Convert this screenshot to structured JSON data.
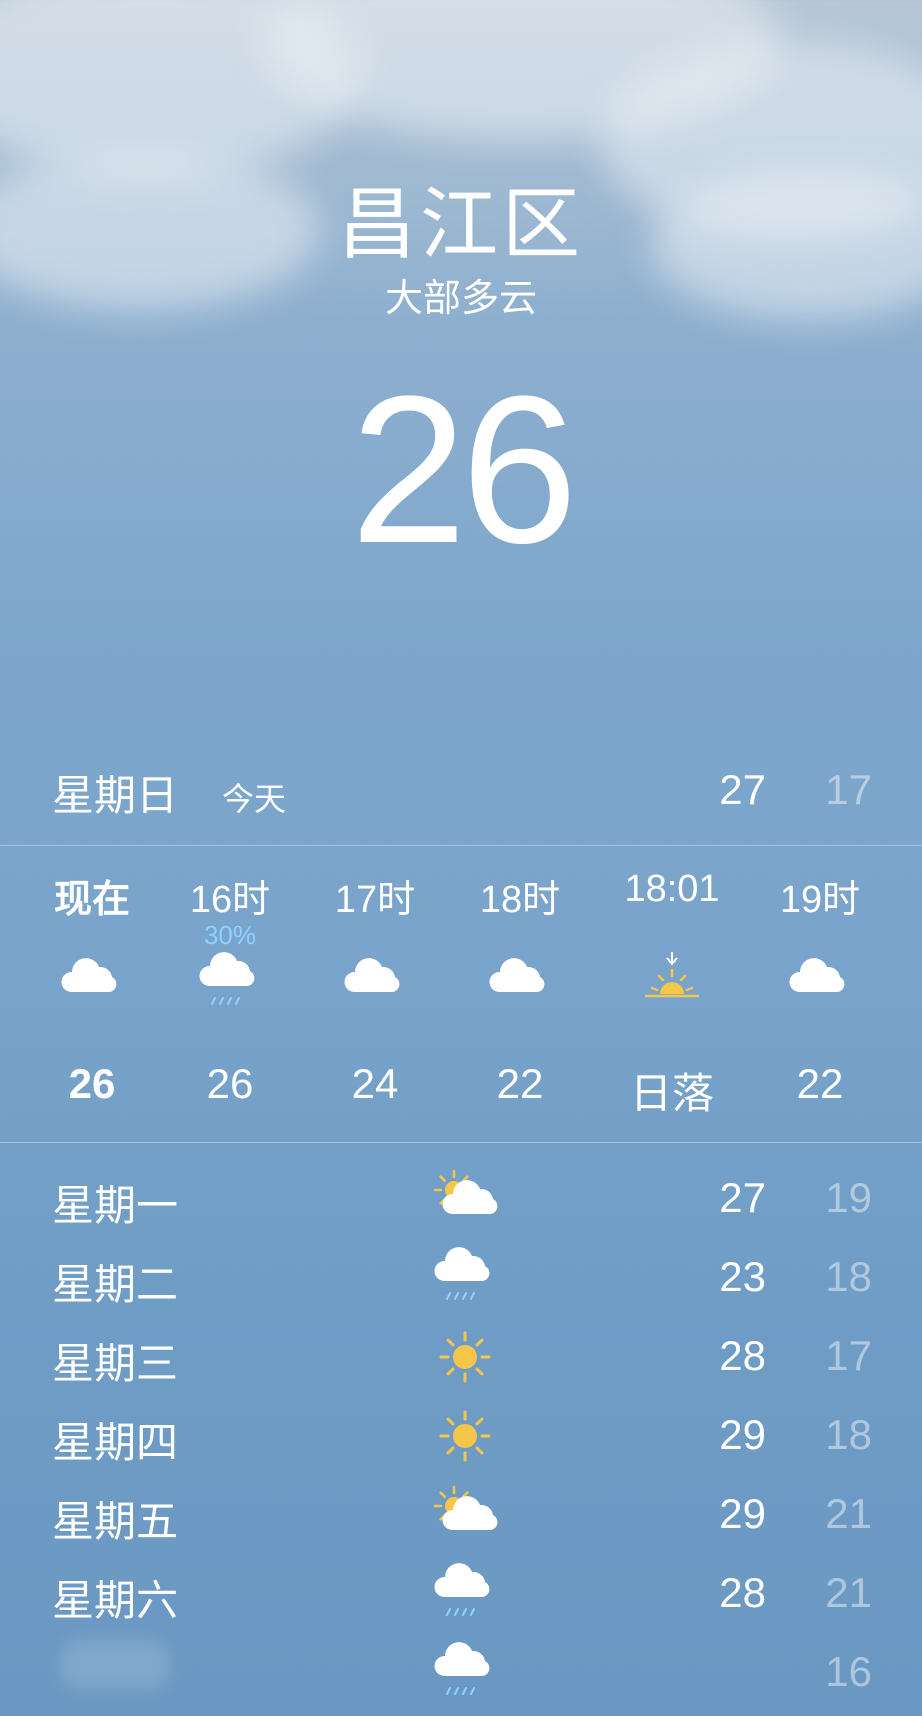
{
  "location": {
    "city": "昌江区",
    "condition": "大部多云",
    "temperature": "26"
  },
  "today": {
    "day": "星期日",
    "tag": "今天",
    "high": "27",
    "low": "17"
  },
  "hourly": [
    {
      "time": "现在",
      "icon": "cloud-icon",
      "value": "26",
      "bold": true,
      "precip": ""
    },
    {
      "time": "16时",
      "icon": "cloud-rain-icon",
      "value": "26",
      "bold": false,
      "precip": "30%"
    },
    {
      "time": "17时",
      "icon": "cloud-icon",
      "value": "24",
      "bold": false,
      "precip": ""
    },
    {
      "time": "18时",
      "icon": "cloud-icon",
      "value": "22",
      "bold": false,
      "precip": ""
    },
    {
      "time": "18:01",
      "icon": "sunset-icon",
      "value": "日落",
      "bold": false,
      "precip": ""
    },
    {
      "time": "19时",
      "icon": "cloud-icon",
      "value": "22",
      "bold": false,
      "precip": ""
    }
  ],
  "daily": [
    {
      "day": "星期一",
      "icon": "partly-cloudy-icon",
      "high": "27",
      "low": "19"
    },
    {
      "day": "星期二",
      "icon": "cloud-rain-icon",
      "high": "23",
      "low": "18"
    },
    {
      "day": "星期三",
      "icon": "sun-icon",
      "high": "28",
      "low": "17"
    },
    {
      "day": "星期四",
      "icon": "sun-icon",
      "high": "29",
      "low": "18"
    },
    {
      "day": "星期五",
      "icon": "partly-cloudy-icon",
      "high": "29",
      "low": "21"
    },
    {
      "day": "星期六",
      "icon": "cloud-rain-icon",
      "high": "28",
      "low": "21"
    },
    {
      "day": "",
      "icon": "cloud-rain-icon",
      "high": "",
      "low": "16"
    }
  ],
  "colors": {
    "precip": "#8fd1ff",
    "sun": "#f6c64a",
    "low_temp": "rgba(255,255,255,0.45)"
  }
}
